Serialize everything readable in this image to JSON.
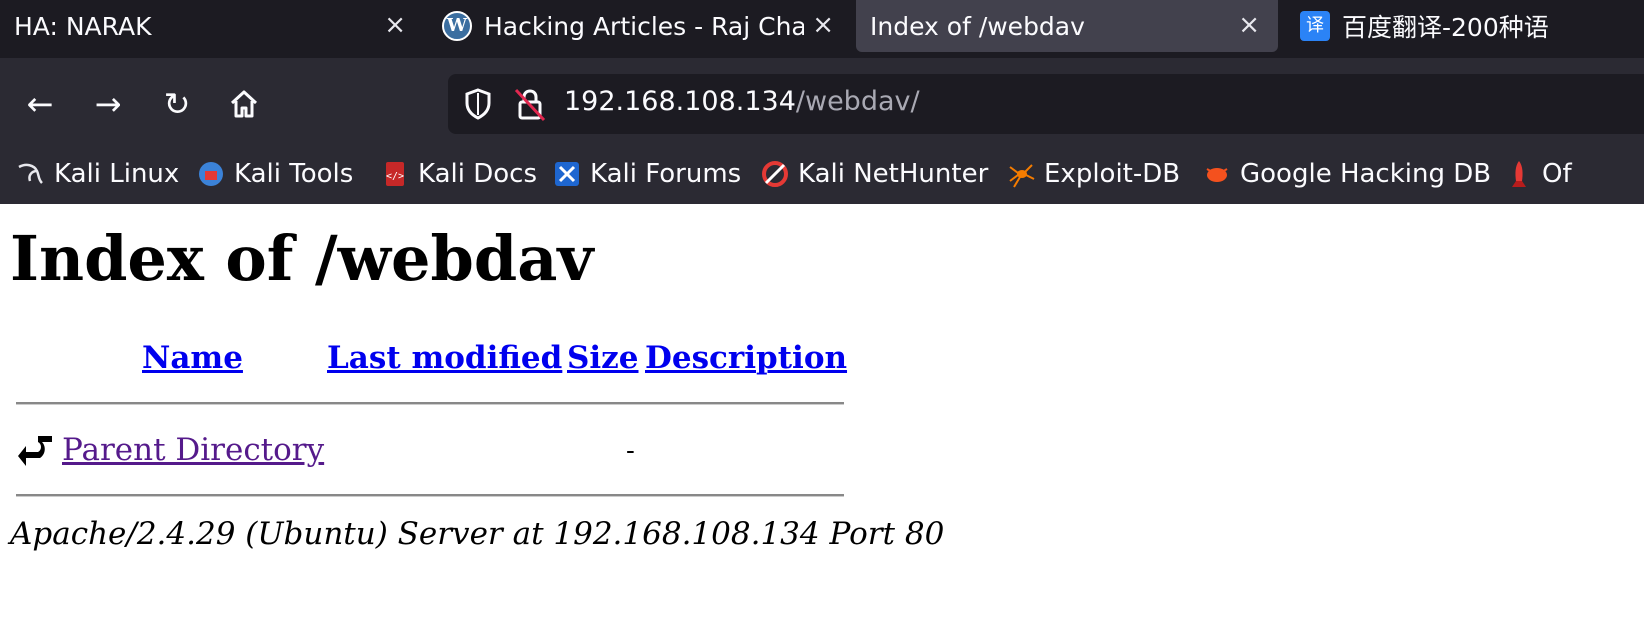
{
  "tabs": [
    {
      "title": "HA: NARAK",
      "close": "×"
    },
    {
      "title": "Hacking Articles - Raj Char",
      "close": "×",
      "favicon": "wordpress-icon"
    },
    {
      "title": "Index of /webdav",
      "close": "×",
      "active": true
    },
    {
      "title": "百度翻译-200种语",
      "favicon": "baidu-translate-icon",
      "favicon_text": "译"
    }
  ],
  "nav": {
    "back": "←",
    "forward": "→",
    "reload": "↻",
    "home": "home-icon"
  },
  "url": {
    "host": "192.168.108.134",
    "path": "/webdav/"
  },
  "bookmarks": [
    {
      "label": "Kali Linux",
      "icon": "kali-dragon-icon"
    },
    {
      "label": "Kali Tools",
      "icon": "kali-tools-icon"
    },
    {
      "label": "Kali Docs",
      "icon": "kali-docs-icon"
    },
    {
      "label": "Kali Forums",
      "icon": "kali-forums-icon"
    },
    {
      "label": "Kali NetHunter",
      "icon": "nethunter-icon"
    },
    {
      "label": "Exploit-DB",
      "icon": "spider-icon"
    },
    {
      "label": "Google Hacking DB",
      "icon": "bug-icon"
    },
    {
      "label": "Of",
      "icon": "rocket-icon"
    }
  ],
  "page": {
    "heading": "Index of /webdav",
    "columns": {
      "name": "Name",
      "last_modified": "Last modified",
      "size": "Size",
      "description": "Description"
    },
    "rows": [
      {
        "name": "Parent Directory",
        "last_modified": "",
        "size": "-",
        "description": "",
        "icon": "back-arrow-icon"
      }
    ],
    "address": "Apache/2.4.29 (Ubuntu) Server at 192.168.108.134 Port 80"
  },
  "colors": {
    "tab_strip": "#1c1b22",
    "toolbar": "#2b2a33",
    "link": "#0000ee",
    "visited_link": "#551a8b"
  }
}
